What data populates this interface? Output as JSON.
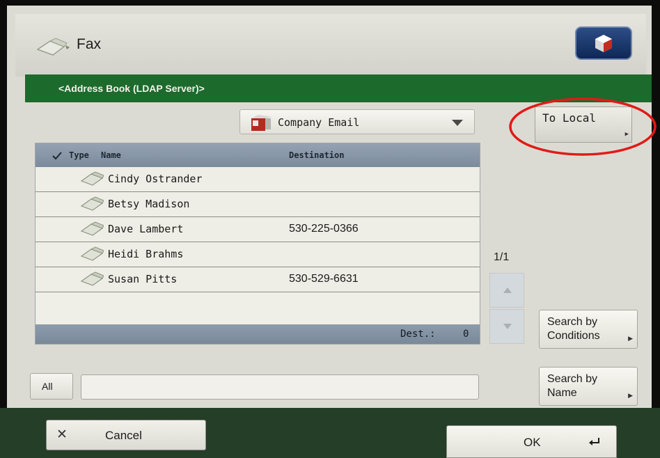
{
  "window": {
    "title": "Fax"
  },
  "subheader": "<Address Book (LDAP Server)>",
  "address_book_select": {
    "selected": "Company Email"
  },
  "to_local_label": "To Local",
  "table": {
    "columns": {
      "type": "Type",
      "name": "Name",
      "destination": "Destination"
    },
    "rows": [
      {
        "name": "Cindy Ostrander",
        "destination": ""
      },
      {
        "name": "Betsy Madison",
        "destination": ""
      },
      {
        "name": "Dave Lambert",
        "destination": "530-225-0366"
      },
      {
        "name": "Heidi Brahms",
        "destination": ""
      },
      {
        "name": "Susan Pitts",
        "destination": "530-529-6631"
      }
    ],
    "footer": {
      "dest_label": "Dest.:",
      "dest_count": "0"
    }
  },
  "pager": {
    "page": "1/1"
  },
  "search_by_conditions": {
    "line1": "Search by",
    "line2": "Conditions"
  },
  "search_by_name": {
    "line1": "Search by",
    "line2": "Name"
  },
  "all_label": "All",
  "search_field": {
    "value": ""
  },
  "cancel_label": "Cancel",
  "ok_label": "OK",
  "colors": {
    "green_bar": "#1c6a2c",
    "highlight": "#e21a17",
    "header_blue": "#7c8b9c"
  },
  "icons": [
    "fax-icon",
    "info-cube-icon",
    "address-book-icon",
    "contact-fax-icon",
    "up-arrow-icon",
    "down-arrow-icon",
    "close-icon",
    "return-icon"
  ]
}
